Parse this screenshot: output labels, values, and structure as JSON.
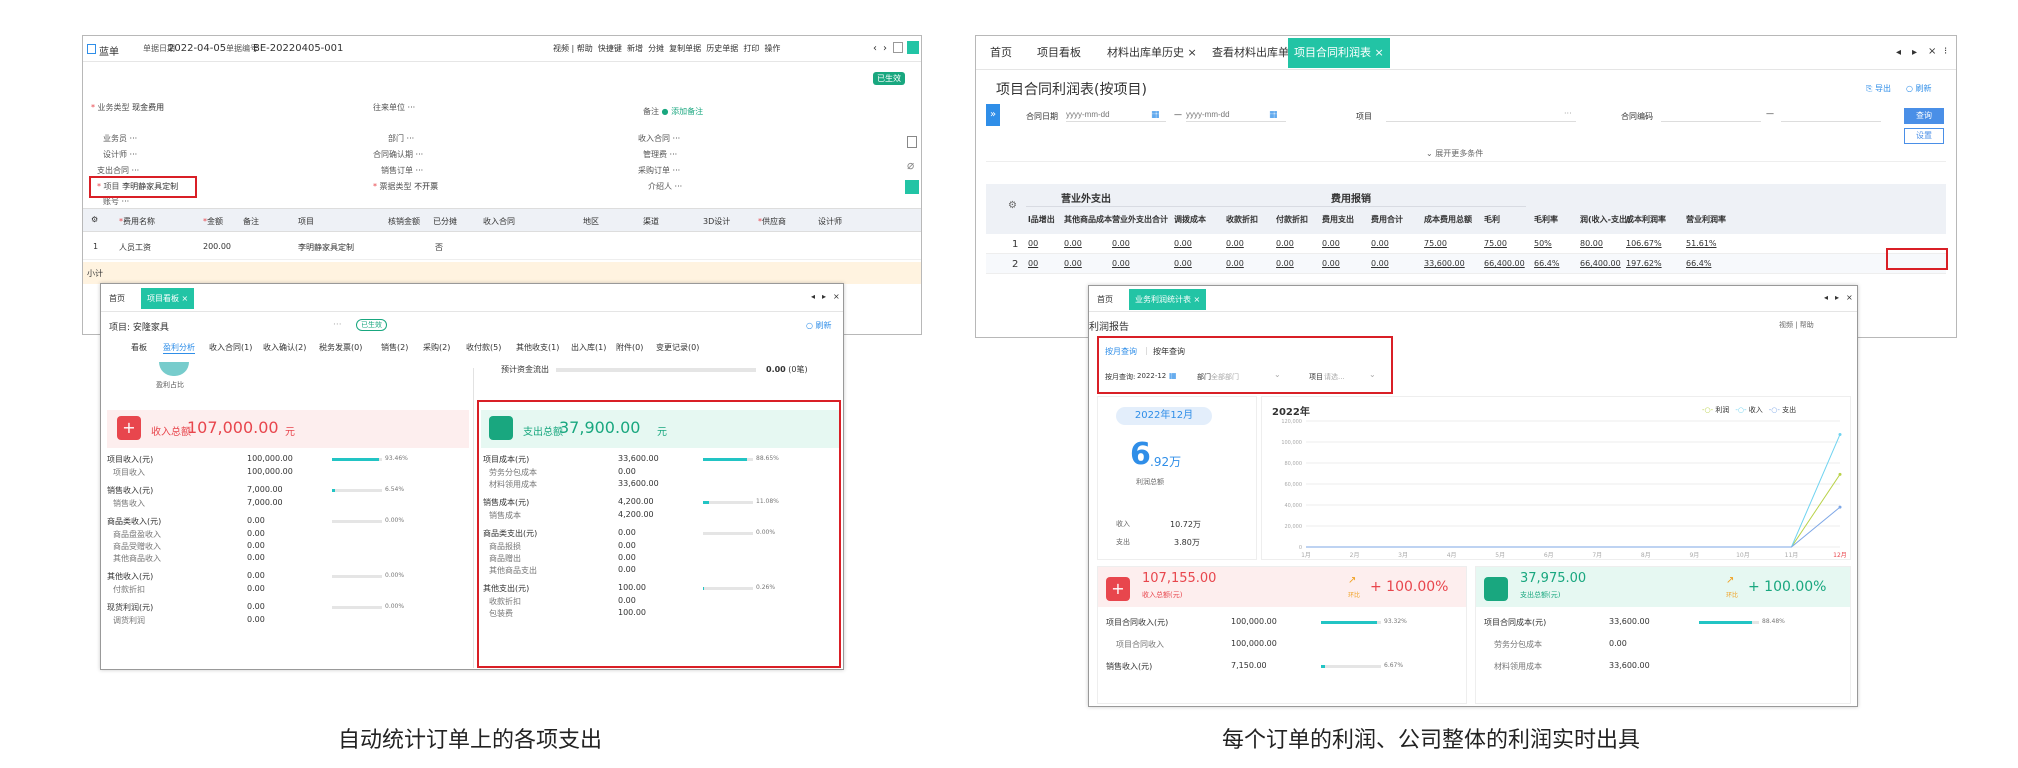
{
  "left": {
    "toolbar": {
      "title": "蓝单",
      "date_label": "单据日期",
      "date": "2022-04-05",
      "no_label": "单据编号",
      "no": "BE-20220405-001",
      "actions": [
        "视频",
        "帮助",
        "快捷键",
        "新增",
        "分摊",
        "复制单据",
        "历史单据",
        "打印",
        "操作"
      ],
      "status": "已生效"
    },
    "form": {
      "biz_type_label": "业务类型",
      "biz_type": "现金费用",
      "partner_label": "往来单位",
      "partner": "···",
      "remark_label": "备注",
      "remark_add": "添加备注",
      "staff_label": "业务员",
      "staff": "···",
      "dept_label": "部门",
      "dept": "···",
      "income_contract_label": "收入合同",
      "income_contract": "···",
      "designer_label": "设计师",
      "designer": "···",
      "confirm_label": "合同确认期",
      "confirm": "···",
      "manager_label": "管理费",
      "manager": "···",
      "expense_contract_label": "支出合同",
      "expense_contract": "···",
      "sales_order_label": "销售订单",
      "sales_order": "···",
      "purchase_order_label": "采购订单",
      "purchase_order": "···",
      "project_label": "项目",
      "project": "李明静家具定制",
      "invoice_label": "票据类型",
      "invoice": "不开票",
      "intro_label": "介绍人",
      "intro": "···",
      "account_label": "账号",
      "account": "···"
    },
    "grid": {
      "headers": [
        "费用名称",
        "金额",
        "备注",
        "项目",
        "核销金额",
        "已分摊",
        "收入合同",
        "地区",
        "渠道",
        "3D设计",
        "供应商",
        "设计师"
      ],
      "row": {
        "no": "1",
        "name": "人员工资",
        "amount": "200.00",
        "project": "李明静家具定制",
        "shared": "否"
      },
      "footer_left": "小计"
    },
    "popup": {
      "tabs": [
        "首页",
        "项目看板"
      ],
      "project_label": "项目:",
      "project": "安隆家具",
      "status_tag": "已生效",
      "refresh": "刷新",
      "subtabs": [
        "看板",
        "盈利分析",
        "收入合同(1)",
        "收入确认(2)",
        "税务发票(0)",
        "销售(2)",
        "采购(2)",
        "收付款(5)",
        "其他收支(1)",
        "出入库(1)",
        "附件(0)",
        "变更记录(0)"
      ],
      "circle_label": "盈利占比",
      "expected_label": "预计资金流出",
      "expected": "0.00",
      "expected_unit": "(0笔)",
      "income": {
        "title": "收入总额",
        "amount": "107,000.00",
        "unit": "元",
        "items": [
          {
            "label": "项目收入(元)",
            "value": "100,000.00",
            "pct": "93.46%",
            "bar": 0.9346
          },
          {
            "label": "项目收入",
            "value": "100,000.00",
            "sub": true
          },
          {
            "label": "销售收入(元)",
            "value": "7,000.00",
            "pct": "6.54%",
            "bar": 0.0654
          },
          {
            "label": "销售收入",
            "value": "7,000.00",
            "sub": true
          },
          {
            "label": "商品类收入(元)",
            "value": "0.00",
            "pct": "0.00%",
            "bar": 0
          },
          {
            "label": "商品盘盈收入",
            "value": "0.00",
            "sub": true
          },
          {
            "label": "商品受赠收入",
            "value": "0.00",
            "sub": true
          },
          {
            "label": "其他商品收入",
            "value": "0.00",
            "sub": true
          },
          {
            "label": "其他收入(元)",
            "value": "0.00",
            "pct": "0.00%",
            "bar": 0
          },
          {
            "label": "付款折扣",
            "value": "0.00",
            "sub": true
          },
          {
            "label": "现货利润(元)",
            "value": "0.00",
            "pct": "0.00%",
            "bar": 0
          },
          {
            "label": "调货利润",
            "value": "0.00",
            "sub": true
          }
        ]
      },
      "expense": {
        "title": "支出总额",
        "amount": "37,900.00",
        "unit": "元",
        "items": [
          {
            "label": "项目成本(元)",
            "value": "33,600.00",
            "pct": "88.65%",
            "bar": 0.8865
          },
          {
            "label": "劳务分包成本",
            "value": "0.00",
            "sub": true
          },
          {
            "label": "材料领用成本",
            "value": "33,600.00",
            "sub": true
          },
          {
            "label": "销售成本(元)",
            "value": "4,200.00",
            "pct": "11.08%",
            "bar": 0.1108
          },
          {
            "label": "销售成本",
            "value": "4,200.00",
            "sub": true
          },
          {
            "label": "商品类支出(元)",
            "value": "0.00",
            "pct": "0.00%",
            "bar": 0
          },
          {
            "label": "商品报损",
            "value": "0.00",
            "sub": true
          },
          {
            "label": "商品赠出",
            "value": "0.00",
            "sub": true
          },
          {
            "label": "其他商品支出",
            "value": "0.00",
            "sub": true
          },
          {
            "label": "其他支出(元)",
            "value": "100.00",
            "pct": "0.26%",
            "bar": 0.0026
          },
          {
            "label": "收款折扣",
            "value": "0.00",
            "sub": true
          },
          {
            "label": "包装费",
            "value": "100.00",
            "sub": true
          }
        ]
      }
    },
    "caption": "自动统计订单上的各项支出"
  },
  "right": {
    "tabs": [
      "首页",
      "项目看板",
      "材料出库单历史",
      "查看材料出库单",
      "项目合同利润表"
    ],
    "title": "项目合同利润表(按项目)",
    "export": "导出",
    "refresh": "刷新",
    "filter": {
      "date_label": "合同日期",
      "date_ph1": "yyyy-mm-dd",
      "date_ph2": "yyyy-mm-dd",
      "project_label": "项目",
      "project_dots": "···",
      "contract_label": "合同编码",
      "query": "查询",
      "settings": "设置",
      "expand": "展开更多条件"
    },
    "table": {
      "group1": "营业外支出",
      "group2": "费用报销",
      "headers": [
        "l品增出",
        "其他商品成本",
        "营业外支出合计",
        "调拨成本",
        "收款折扣",
        "付款折扣",
        "费用支出",
        "费用合计",
        "成本费用总额",
        "毛利",
        "毛利率",
        "润(收入-支出)",
        "成本利润率",
        "营业利润率"
      ],
      "rows": [
        {
          "no": "1",
          "cells": [
            "00",
            "0.00",
            "0.00",
            "0.00",
            "0.00",
            "0.00",
            "0.00",
            "0.00",
            "75.00",
            "75.00",
            "50%",
            "80.00",
            "106.67%",
            "51.61%"
          ]
        },
        {
          "no": "2",
          "cells": [
            "00",
            "0.00",
            "0.00",
            "0.00",
            "0.00",
            "0.00",
            "0.00",
            "0.00",
            "33,600.00",
            "66,400.00",
            "66.4%",
            "66,400.00",
            "197.62%",
            "66.4%"
          ]
        }
      ]
    },
    "popup": {
      "tabs": [
        "首页",
        "业务利润统计表"
      ],
      "title": "利润报告",
      "top_links": "视频 | 帮助",
      "mode_tabs": [
        "按月查询",
        "按年查询"
      ],
      "month_label": "按月查询:",
      "month": "2022-12",
      "dept_label": "部门",
      "dept_ph": "全部部门",
      "project_label": "项目",
      "project_ph": "请选...",
      "period": "2022年12月",
      "profit_big": "6",
      "profit_small": ".92万",
      "profit_label": "利润总额",
      "income_label": "收入",
      "income_val": "10.72万",
      "expense_label": "支出",
      "expense_val": "3.80万",
      "chart_title": "2022年",
      "income_card": {
        "amount": "107,155.00",
        "label": "收入总额(元)",
        "trend": "环比",
        "change": "+ 100.00%",
        "items": [
          {
            "label": "项目合同收入(元)",
            "value": "100,000.00",
            "pct": "93.32%",
            "bar": 0.9332
          },
          {
            "label": "项目合同收入",
            "value": "100,000.00",
            "sub": true
          },
          {
            "label": "销售收入(元)",
            "value": "7,150.00",
            "pct": "6.67%",
            "bar": 0.0667
          }
        ]
      },
      "expense_card": {
        "amount": "37,975.00",
        "label": "支出总额(元)",
        "trend": "环比",
        "change": "+ 100.00%",
        "items": [
          {
            "label": "项目合同成本(元)",
            "value": "33,600.00",
            "pct": "88.48%",
            "bar": 0.8848
          },
          {
            "label": "劳务分包成本",
            "value": "0.00",
            "sub": true
          },
          {
            "label": "材料领用成本",
            "value": "33,600.00",
            "sub": true
          }
        ]
      }
    },
    "caption": "每个订单的利润、公司整体的利润实时出具"
  },
  "chart_data": {
    "type": "line",
    "title": "2022年",
    "x": [
      "1月",
      "2月",
      "3月",
      "4月",
      "5月",
      "6月",
      "7月",
      "8月",
      "9月",
      "10月",
      "11月",
      "12月"
    ],
    "ylim": [
      0,
      120000
    ],
    "yticks": [
      "120,000",
      "100,000",
      "80,000",
      "60,000",
      "40,000",
      "20,000",
      "0"
    ],
    "series": [
      {
        "name": "利润",
        "color": "#b9d24a",
        "values": [
          0,
          0,
          0,
          0,
          0,
          0,
          0,
          0,
          0,
          0,
          0,
          69200
        ]
      },
      {
        "name": "收入",
        "color": "#6fd3f0",
        "values": [
          0,
          0,
          0,
          0,
          0,
          0,
          0,
          0,
          0,
          0,
          0,
          107155
        ]
      },
      {
        "name": "支出",
        "color": "#7ea7e6",
        "values": [
          0,
          0,
          0,
          0,
          0,
          0,
          0,
          0,
          0,
          0,
          0,
          37975
        ]
      }
    ]
  },
  "colors": {
    "teal": "#22c4a5",
    "red": "#e8464d",
    "green": "#19a77f",
    "blue": "#2f8ee8",
    "redbox": "#d91f26"
  }
}
